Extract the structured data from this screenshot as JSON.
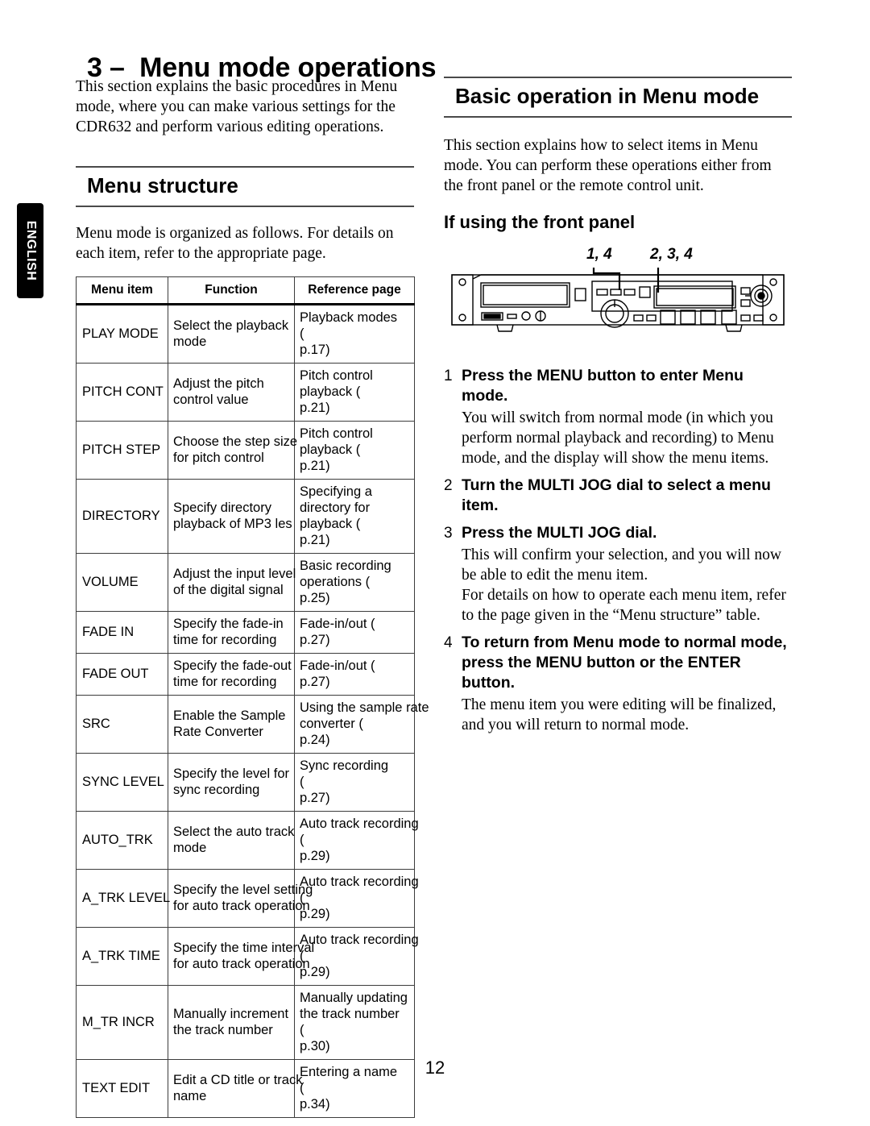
{
  "page": {
    "language_tab": "ENGLISH",
    "chapter_title": "3 –  Menu mode operations",
    "page_number": "12"
  },
  "left_column": {
    "intro_paragraph": "This section explains the basic procedures in Menu mode, where you can make various settings for the CDR632 and perform various editing operations.",
    "menu_structure": {
      "heading": "Menu structure",
      "lead_paragraph": "Menu mode is organized as follows. For details on each item, refer to the appropriate page.",
      "table": {
        "headers": [
          "Menu item",
          "Function",
          "Reference page"
        ],
        "rows": [
          {
            "item": "PLAY MODE",
            "function": [
              "Select the playback",
              "mode"
            ],
            "reference": [
              "Playback modes",
              "(",
              "p.17)"
            ]
          },
          {
            "item": "PITCH CONT",
            "function": [
              "Adjust the pitch",
              "control value"
            ],
            "reference": [
              "Pitch control",
              "playback (",
              "p.21)"
            ]
          },
          {
            "item": "PITCH STEP",
            "function": [
              "Choose the step size",
              "for pitch control"
            ],
            "reference": [
              "Pitch control",
              "playback (",
              "p.21)"
            ]
          },
          {
            "item": "DIRECTORY",
            "function": [
              "Specify directory",
              "playback of MP3  les"
            ],
            "reference": [
              "Specifying a",
              "directory for",
              "playback (",
              "p.21)"
            ]
          },
          {
            "item": "VOLUME",
            "function": [
              "Adjust the input level",
              "of the digital signal"
            ],
            "reference": [
              "Basic recording",
              "operations (",
              "p.25)"
            ]
          },
          {
            "item": "FADE IN",
            "function": [
              "Specify the fade-in",
              "time for recording"
            ],
            "reference": [
              "Fade-in/out (",
              "p.27)"
            ]
          },
          {
            "item": "FADE OUT",
            "function": [
              "Specify the fade-out",
              "time for recording"
            ],
            "reference": [
              "Fade-in/out (",
              "p.27)"
            ]
          },
          {
            "item": "SRC",
            "function": [
              "Enable the Sample",
              "Rate Converter"
            ],
            "reference": [
              "Using the sample rate",
              "converter (",
              "p.24)"
            ]
          },
          {
            "item": "SYNC LEVEL",
            "function": [
              "Specify the level for",
              "sync recording"
            ],
            "reference": [
              "Sync recording",
              "(",
              "p.27)"
            ]
          },
          {
            "item": "AUTO_TRK",
            "function": [
              "Select the auto track",
              "mode"
            ],
            "reference": [
              "Auto track recording",
              "(",
              "p.29)"
            ]
          },
          {
            "item": "A_TRK LEVEL",
            "function": [
              "Specify the level setting",
              "for auto track operation"
            ],
            "reference": [
              "Auto track recording",
              "(",
              "p.29)"
            ]
          },
          {
            "item": "A_TRK TIME",
            "function": [
              "Specify the time interval",
              "for auto track operation"
            ],
            "reference": [
              "Auto track recording",
              "(",
              "p.29)"
            ]
          },
          {
            "item": "M_TR INCR",
            "function": [
              "Manually increment",
              "the track number"
            ],
            "reference": [
              "Manually updating",
              "the track number",
              "(",
              "p.30)"
            ]
          },
          {
            "item": "TEXT EDIT",
            "function": [
              "Edit a CD title or track",
              "name"
            ],
            "reference": [
              "Entering a name",
              "(",
              "p.34)"
            ]
          }
        ]
      }
    }
  },
  "right_column": {
    "basic_operation": {
      "heading": "Basic operation in Menu mode",
      "lead_paragraph": "This section explains how to select items in Menu mode. You can perform these operations either from the front panel or the remote control unit.",
      "subheading": "If using the front panel"
    },
    "figure": {
      "callout_left": "1, 4",
      "callout_right": "2, 3, 4"
    },
    "steps": [
      {
        "number": "1",
        "title": "Press the MENU button to enter Menu mode.",
        "body": [
          "You will switch from normal mode (in which you perform normal playback and recording) to Menu mode, and the display will show the menu items."
        ]
      },
      {
        "number": "2",
        "title": "Turn the MULTI JOG dial to select a menu item.",
        "body": []
      },
      {
        "number": "3",
        "title": "Press the MULTI JOG dial.",
        "body": [
          "This will confirm your selection, and you will now be able to edit the menu item.",
          "For details on how to operate each menu item, refer to the page given in the “Menu structure” table."
        ]
      },
      {
        "number": "4",
        "title": "To return from Menu mode to normal mode, press the MENU button or the ENTER button.",
        "body": [
          "The menu item you were editing will be finalized, and you will return to normal mode."
        ]
      }
    ]
  }
}
